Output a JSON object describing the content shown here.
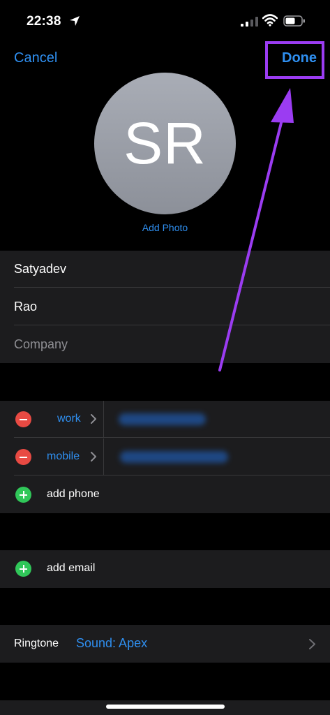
{
  "status_bar": {
    "time": "22:38"
  },
  "nav": {
    "cancel_label": "Cancel",
    "done_label": "Done"
  },
  "avatar": {
    "initials": "SR",
    "add_photo_label": "Add Photo"
  },
  "name_fields": {
    "first_name": "Satyadev",
    "last_name": "Rao",
    "company_placeholder": "Company"
  },
  "phones": [
    {
      "label": "work"
    },
    {
      "label": "mobile"
    }
  ],
  "add_phone_label": "add phone",
  "add_email_label": "add email",
  "ringtone": {
    "label": "Ringtone",
    "value": "Sound: Apex"
  },
  "colors": {
    "accent": "#2f8ff0",
    "highlight": "#9b3cf2",
    "delete": "#e84a43",
    "add": "#30c759"
  },
  "icons": [
    "location-arrow-icon",
    "signal-icon",
    "wifi-icon",
    "battery-icon",
    "chevron-right-icon",
    "minus-circle-icon",
    "plus-circle-icon"
  ]
}
